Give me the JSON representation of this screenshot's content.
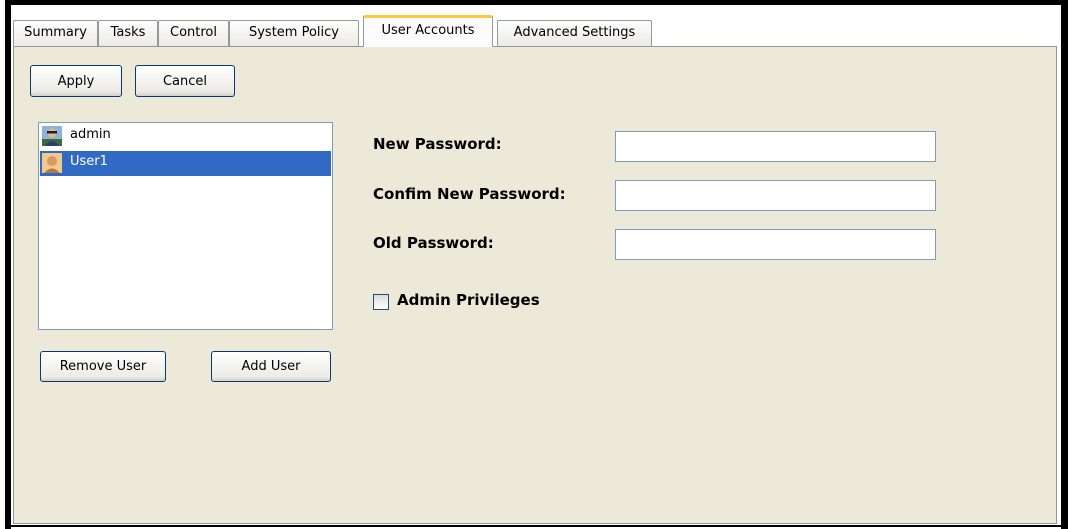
{
  "tabs": [
    {
      "label": "Summary",
      "active": false
    },
    {
      "label": "Tasks",
      "active": false
    },
    {
      "label": "Control",
      "active": false
    },
    {
      "label": "System Policy",
      "active": false
    },
    {
      "label": "User Accounts",
      "active": true
    },
    {
      "label": "Advanced Settings",
      "active": false
    }
  ],
  "toolbar": {
    "apply_label": "Apply",
    "cancel_label": "Cancel"
  },
  "users": {
    "items": [
      {
        "name": "admin",
        "selected": false,
        "icon": "admin-avatar-icon"
      },
      {
        "name": "User1",
        "selected": true,
        "icon": "user-avatar-icon"
      }
    ],
    "remove_label": "Remove User",
    "add_label": "Add User"
  },
  "form": {
    "new_password_label": "New Password:",
    "new_password_value": "",
    "confirm_password_label": "Confim New Password:",
    "confirm_password_value": "",
    "old_password_label": "Old Password:",
    "old_password_value": "",
    "admin_privileges_label": "Admin Privileges",
    "admin_privileges_checked": false
  },
  "colors": {
    "panel_bg": "#ece9d8",
    "selection": "#316ac5",
    "active_tab_accent": "#ffc83c",
    "border": "#919b9c"
  }
}
